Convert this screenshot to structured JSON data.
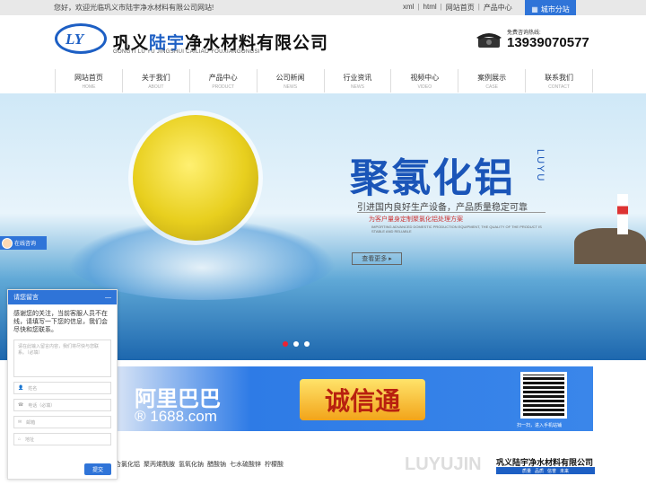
{
  "topbar": {
    "welcome": "您好，欢迎光临巩义市陆宇净水材料有限公司网站!",
    "links": [
      "xml",
      "html",
      "网站首页",
      "产品中心"
    ],
    "city_label": "城市分站"
  },
  "header": {
    "logo_text": "LY",
    "company_prefix": "巩义",
    "company_highlight": "陆宇",
    "company_suffix": "净水材料有限公司",
    "pinyin": "GONGYI LU YU JINGSHUI  CAILIAO YOUXIANGONGSI",
    "phone_label": "免费咨询热线:",
    "phone": "13939070577"
  },
  "nav": [
    {
      "zh": "网站首页",
      "en": "HOME"
    },
    {
      "zh": "关于我们",
      "en": "ABOUT"
    },
    {
      "zh": "产品中心",
      "en": "PRODUCT"
    },
    {
      "zh": "公司新闻",
      "en": "NEWS"
    },
    {
      "zh": "行业资讯",
      "en": "NEWS"
    },
    {
      "zh": "视频中心",
      "en": "VIDEO"
    },
    {
      "zh": "案例展示",
      "en": "CASE"
    },
    {
      "zh": "联系我们",
      "en": "CONTACT"
    }
  ],
  "banner": {
    "title": "聚氯化铝",
    "vertical": "LUYU",
    "sub1": "引进国内良好生产设备，产品质量稳定可靠",
    "sub2": "为客户量身定制聚氯化铝处理方案",
    "sub3": "IMPORTING ADVANCED DOMESTIC PRODUCTION EQUIPMENT, THE QUALITY OF THE PRODUCT IS STABLE AND RELIABLE",
    "more": "查看更多"
  },
  "consult": {
    "label": "在线咨询"
  },
  "chat": {
    "title": "请您留言",
    "close": "—",
    "message": "感谢您的关注，当前客服人员不在线，请填写一下您的信息，我们会尽快和您联系。",
    "placeholder": "请在此输入留言内容，我们将尽快与您联系。（必填）",
    "fields": [
      "姓名",
      "电话（必填）",
      "邮箱",
      "地址"
    ],
    "submit": "提交"
  },
  "ali": {
    "name": "阿里巴巴",
    "domain": "® 1688.com",
    "cxt": "诚信通",
    "qr_caption": "扫一扫，进入手机站铺"
  },
  "products": [
    "聚合氯化铝",
    "聚丙烯酰胺",
    "氢氧化钠",
    "醋酸钠",
    "七水硫酸锌",
    "柠檬酸"
  ],
  "footer": {
    "watermark": "LUYUJIN",
    "company": "巩义陆宇净水材料有限公司",
    "tags": [
      "质量",
      "品质",
      "信誉",
      "未来"
    ]
  }
}
